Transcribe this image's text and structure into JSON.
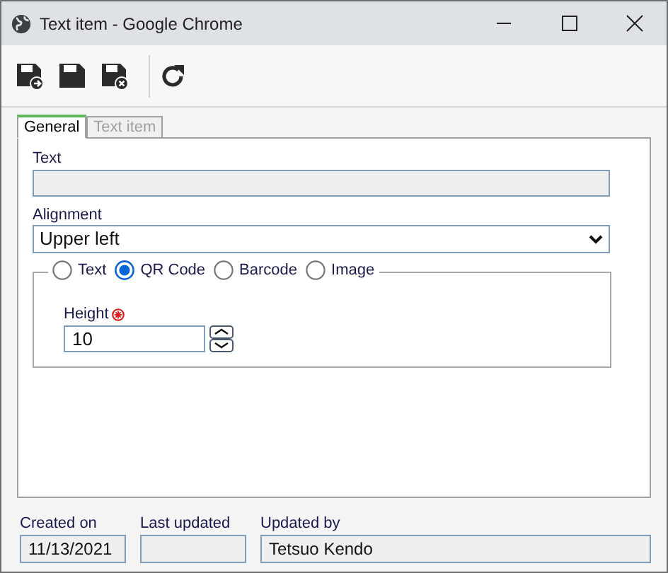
{
  "window": {
    "title": "Text item - Google Chrome"
  },
  "tabs": [
    {
      "label": "General",
      "selected": true,
      "disabled": false
    },
    {
      "label": "Text item",
      "selected": false,
      "disabled": true
    }
  ],
  "text_field": {
    "label": "Text"
  },
  "alignment": {
    "label": "Alignment",
    "value": "Upper left"
  },
  "content_types": [
    {
      "label": "Text",
      "selected": false
    },
    {
      "label": "QR Code",
      "selected": true
    },
    {
      "label": "Barcode",
      "selected": false
    },
    {
      "label": "Image",
      "selected": false
    }
  ],
  "height": {
    "label": "Height",
    "required": true,
    "value": "10"
  },
  "footer": [
    {
      "label": "Created on",
      "value": "11/13/2021"
    },
    {
      "label": "Last updated"
    },
    {
      "label": "Updated by",
      "value": "Tetsuo Kendo"
    }
  ]
}
